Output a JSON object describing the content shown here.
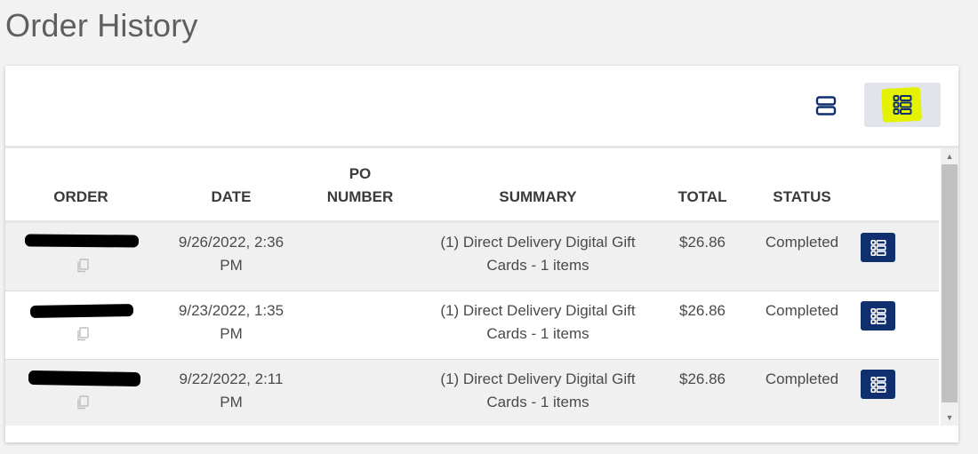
{
  "page": {
    "title": "Order History"
  },
  "toolbar": {
    "card_view_icon": "card-view-icon",
    "list_view_icon": "list-view-icon",
    "active_view": "list",
    "highlight_color": "#e4f200"
  },
  "table": {
    "headers": {
      "order": "ORDER",
      "date": "DATE",
      "po_number_line1": "PO",
      "po_number_line2": "NUMBER",
      "summary": "SUMMARY",
      "total": "TOTAL",
      "status": "STATUS"
    },
    "rows": [
      {
        "order": "[redacted]",
        "date_line1": "9/26/2022, 2:36",
        "date_line2": "PM",
        "po_number": "",
        "summary_line1": "(1) Direct Delivery Digital Gift",
        "summary_line2": "Cards - 1 items",
        "total": "$26.86",
        "status": "Completed"
      },
      {
        "order": "[redacted]",
        "date_line1": "9/23/2022, 1:35",
        "date_line2": "PM",
        "po_number": "",
        "summary_line1": "(1) Direct Delivery Digital Gift",
        "summary_line2": "Cards - 1 items",
        "total": "$26.86",
        "status": "Completed"
      },
      {
        "order": "[redacted]",
        "date_line1": "9/22/2022, 2:11",
        "date_line2": "PM",
        "po_number": "",
        "summary_line1": "(1) Direct Delivery Digital Gift",
        "summary_line2": "Cards - 1 items",
        "total": "$26.86",
        "status": "Completed"
      }
    ]
  },
  "colors": {
    "primary_button": "#0f2f6e",
    "row_shade": "#f0f0f0"
  }
}
